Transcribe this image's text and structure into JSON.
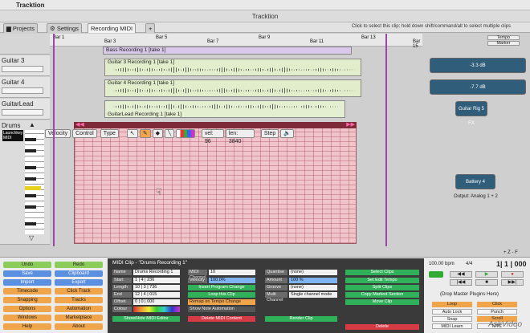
{
  "app": {
    "name": "Tracktion",
    "window_title": "Tracktion"
  },
  "tabs": {
    "projects": "Projects",
    "settings": "Settings",
    "edit": "Recording MIDI",
    "add": "+"
  },
  "hint": "Click to select this clip; hold down shift/command/alt to select multiple clips",
  "ruler": {
    "bars": [
      "Bar 1",
      "Bar 3",
      "Bar 5",
      "Bar 7",
      "Bar 9",
      "Bar 11",
      "Bar 13",
      "Bar 15"
    ]
  },
  "tracks": [
    {
      "name": "Guitar 3",
      "clip": "Guitar 3 Recording 1 [take 1]"
    },
    {
      "name": "Guitar 4",
      "clip": "Guitar 4 Recording 1 [take 1]"
    },
    {
      "name": "GuitarLead",
      "clip": "GuitarLead Recording 1 [take 1]"
    },
    {
      "name": "Drums",
      "clip": "Drums Recording 1"
    }
  ],
  "bass_clip": "Bass Recording 1 [take 1]",
  "drums_input": "Launchkey MIDI",
  "midi_toolbar": {
    "velocity": "Velocity",
    "control": "Control",
    "type": "Type",
    "vel": "vel: 96",
    "len": "len: 3840",
    "step": "Step"
  },
  "right": {
    "tempo": "Tempo",
    "marker": "Marker",
    "plugins": [
      "-3.3 dB",
      "-7.7 dB",
      "Guitar Rig 5 FX",
      "Battery 4"
    ],
    "output": "Output: Analog 1 + 2"
  },
  "zoom": "+ Z -  F",
  "left_buttons": [
    [
      "Undo",
      "Redo"
    ],
    [
      "Save",
      "Clipboard"
    ],
    [
      "Import",
      "Export"
    ],
    [
      "Timecode",
      "Click Track"
    ],
    [
      "Snapping",
      "Tracks"
    ],
    [
      "Options",
      "Automation"
    ],
    [
      "Windows",
      "Marketplace"
    ],
    [
      "Help",
      "About"
    ]
  ],
  "props": {
    "title": "MIDI Clip - \"Drums Recording 1\"",
    "name_label": "Name",
    "name_value": "Drums Recording 1",
    "start_label": "Start",
    "start_value": "1 | 4 | 236",
    "length_label": "Length",
    "length_value": "10 | 3 | 736",
    "end_label": "End",
    "end_value": "12 | 4 | 015",
    "offset_label": "Offset",
    "offset_value": "0 | 0 | 000",
    "colour_label": "Colour",
    "midi_channel_label": "MIDI Channel",
    "midi_channel_value": "10",
    "velocity_label": "Velocity",
    "velocity_value": "100.0%",
    "insert_program": "Insert Program Change",
    "loop": "Loop this Clip",
    "remap": "Remap on Tempo Change",
    "show_auto": "Show Note Automation",
    "quantise_label": "Quantise",
    "quantise_value": "(none)",
    "amount_label": "Amount",
    "amount_value": "100 %",
    "groove_label": "Groove",
    "groove_value": "(none)",
    "multi_label": "Multi Channel",
    "multi_value": "Single channel mode",
    "select_clips": "Select Clips",
    "set_edit_tempo": "Set Edit Tempo",
    "split_clips": "Split Clips",
    "copy_marked": "Copy Marked Section",
    "move_clip": "Move Clip",
    "show_midi": "Show/Hide MIDI Editor",
    "delete_midi": "Delete MIDI Content",
    "render": "Render Clip",
    "delete": "Delete"
  },
  "transport": {
    "tempo": "100.00 bpm",
    "sig": "4/4",
    "position": "1| 1 | 000",
    "drop": "(Drop Master Plugins Here)",
    "loop": "Loop",
    "click": "Click",
    "autolock": "Auto Lock",
    "punch": "Punch",
    "snap": "Snap",
    "scroll": "Scroll",
    "midilearn": "MIDI Learn",
    "mtc": "MTC"
  },
  "watermark": "AskVideo"
}
